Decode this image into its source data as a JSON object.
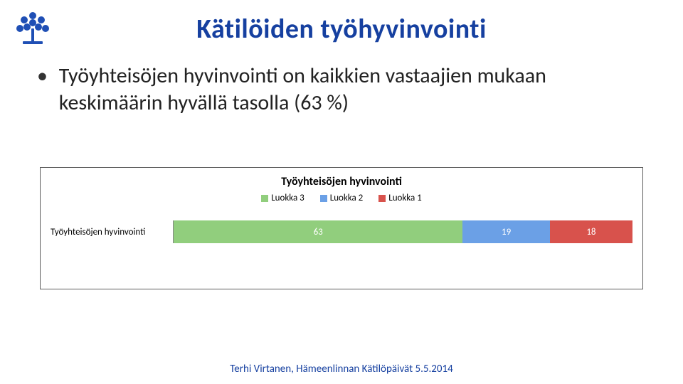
{
  "title": "Kätilöiden työhyvinvointi",
  "bullet": "Työyhteisöjen hyvinvointi on kaikkien vastaajien mukaan keskimäärin hyvällä tasolla (63 %)",
  "chart_data": {
    "type": "bar",
    "orientation": "horizontal-stacked",
    "title": "Työyhteisöjen hyvinvointi",
    "categories": [
      "Työyhteisöjen hyvinvointi"
    ],
    "series": [
      {
        "name": "Luokka 3",
        "color": "#91ce7d",
        "values": [
          63
        ]
      },
      {
        "name": "Luokka 2",
        "color": "#6ba0e6",
        "values": [
          19
        ]
      },
      {
        "name": "Luokka 1",
        "color": "#d8524c",
        "values": [
          18
        ]
      }
    ],
    "xlim": [
      0,
      100
    ],
    "xlabel": "",
    "ylabel": ""
  },
  "legend": {
    "l3": "Luokka 3",
    "l2": "Luokka 2",
    "l1": "Luokka 1"
  },
  "bar_labels": {
    "category": "Työyhteisöjen hyvinvointi",
    "v3": "63",
    "v2": "19",
    "v1": "18"
  },
  "footer": "Terhi Virtanen, Hämeenlinnan Kätilöpäivät 5.5.2014",
  "logo_alt": "tree-logo"
}
